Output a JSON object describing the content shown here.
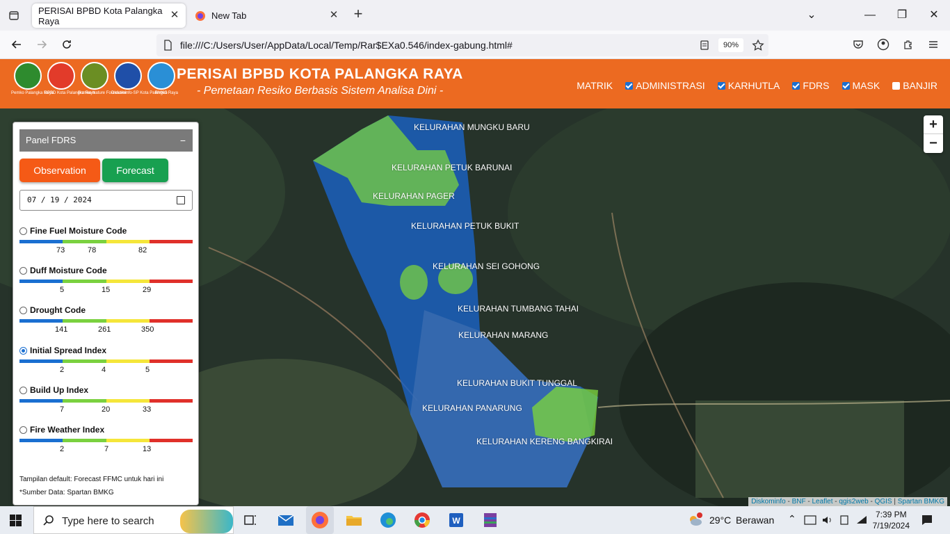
{
  "browser": {
    "tabs": [
      {
        "title": "PERISAI BPBD Kota Palangka Raya",
        "active": true
      },
      {
        "title": "New Tab",
        "active": false
      }
    ],
    "url": "file:///C:/Users/User/AppData/Local/Temp/Rar$EXa0.546/index-gabung.html#",
    "zoom": "90%"
  },
  "header": {
    "title": "PERISAI BPBD KOTA PALANGKA RAYA",
    "subtitle": "- Pemetaan Resiko Berbasis Sistem Analisa Dini -",
    "logos": [
      {
        "caption": "Pemko Palangka Raya",
        "color": "#2e8b2e"
      },
      {
        "caption": "BPBD Kota Palangka Raya",
        "color": "#e23b2a"
      },
      {
        "caption": "Borneo Nature Foundation",
        "color": "#6b8e23"
      },
      {
        "caption": "Diskominfo-SP Kota Palangka Raya",
        "color": "#1f4fa8"
      },
      {
        "caption": "BMKG",
        "color": "#2a8fd6"
      }
    ],
    "menu": [
      {
        "label": "MATRIK",
        "checkbox": false
      },
      {
        "label": "ADMINISTRASI",
        "checkbox": true,
        "checked": true
      },
      {
        "label": "KARHUTLA",
        "checkbox": true,
        "checked": true
      },
      {
        "label": "FDRS",
        "checkbox": true,
        "checked": true
      },
      {
        "label": "MASK",
        "checkbox": true,
        "checked": true
      },
      {
        "label": "BANJIR",
        "checkbox": true,
        "checked": false
      }
    ]
  },
  "map": {
    "zoom_in": "+",
    "zoom_out": "−",
    "kelurahan": [
      "KELURAHAN MUNGKU BARU",
      "KELURAHAN PETUK BARUNAI",
      "KELURAHAN PAGER",
      "KELURAHAN PETUK BUKIT",
      "KELURAHAN SEI GOHONG",
      "KELURAHAN TUMBANG TAHAI",
      "KELURAHAN MARANG",
      "KELURAHAN BUKIT TUNGGAL",
      "KELURAHAN PANARUNG",
      "KELURAHAN KERENG BANGKIRAI"
    ],
    "attribution": [
      "Diskominfo",
      "BNF",
      "Leaflet",
      "qgis2web",
      "QGIS",
      "Spartan BMKG"
    ]
  },
  "panel": {
    "title": "Panel FDRS",
    "collapse": "−",
    "btn_observation": "Observation",
    "btn_forecast": "Forecast",
    "date": "07 / 19 / 2024",
    "scale_colors": [
      "#1a6fd1",
      "#7ad13f",
      "#f5e63a",
      "#e0302a"
    ],
    "indices": [
      {
        "label": "Fine Fuel Moisture Code",
        "ticks": [
          "73",
          "78",
          "82"
        ],
        "selected": false
      },
      {
        "label": "Duff Moisture Code",
        "ticks": [
          "5",
          "15",
          "29"
        ],
        "selected": false
      },
      {
        "label": "Drought Code",
        "ticks": [
          "141",
          "261",
          "350"
        ],
        "selected": false
      },
      {
        "label": "Initial Spread Index",
        "ticks": [
          "2",
          "4",
          "5"
        ],
        "selected": true
      },
      {
        "label": "Build Up Index",
        "ticks": [
          "7",
          "20",
          "33"
        ],
        "selected": false
      },
      {
        "label": "Fire Weather Index",
        "ticks": [
          "2",
          "7",
          "13"
        ],
        "selected": false
      }
    ],
    "note": "Tampilan default: Forecast FFMC untuk hari ini",
    "source": "*Sumber Data: Spartan BMKG"
  },
  "taskbar": {
    "search_placeholder": "Type here to search",
    "weather_temp": "29°C",
    "weather_desc": "Berawan",
    "time": "7:39 PM",
    "date": "7/19/2024"
  }
}
